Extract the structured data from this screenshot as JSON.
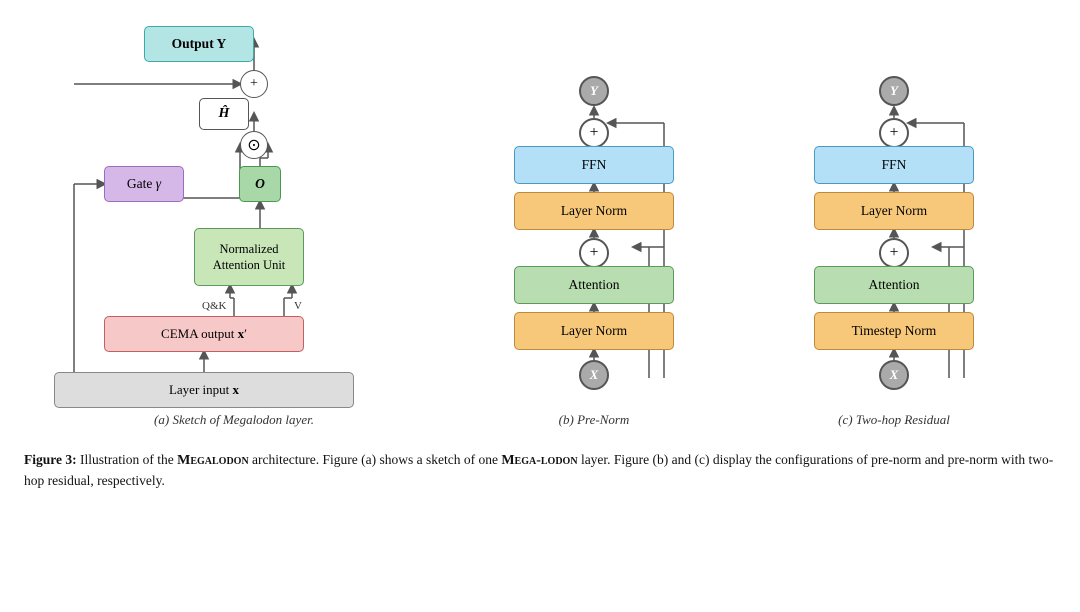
{
  "figures": {
    "a": {
      "caption": "(a) Sketch of Megalodon layer.",
      "boxes": {
        "output": "Output Y",
        "hhat": "Ĥ",
        "gate": "Gate γ",
        "o": "O",
        "nau": "Normalized\nAttention Unit",
        "cema": "CEMA output x′",
        "input": "Layer input x"
      },
      "labels": {
        "qk": "Q&K",
        "v": "V",
        "plus": "+",
        "dot": "⊙"
      }
    },
    "b": {
      "caption": "(b) Pre-Norm",
      "nodes": {
        "y_top": "Y",
        "x_bottom": "X",
        "plus_top": "+",
        "plus_mid": "+"
      },
      "boxes": {
        "ffn": "FFN",
        "layernorm_top": "Layer Norm",
        "attention": "Attention",
        "layernorm_bot": "Layer Norm"
      }
    },
    "c": {
      "caption": "(c) Two-hop Residual",
      "nodes": {
        "y_top": "Y",
        "x_bottom": "X",
        "plus_top": "+",
        "plus_mid": "+"
      },
      "boxes": {
        "ffn": "FFN",
        "layernorm_top": "Layer Norm",
        "attention": "Attention",
        "timestepnorm": "Timestep Norm"
      }
    }
  },
  "figure_caption": {
    "label": "Figure 3:",
    "text": "Illustration of the MEGALODON architecture. Figure (a) shows a sketch of one MEGALODON layer. Figure (b) and (c) display the configurations of pre-norm and pre-norm with two-hop residual, respectively."
  }
}
